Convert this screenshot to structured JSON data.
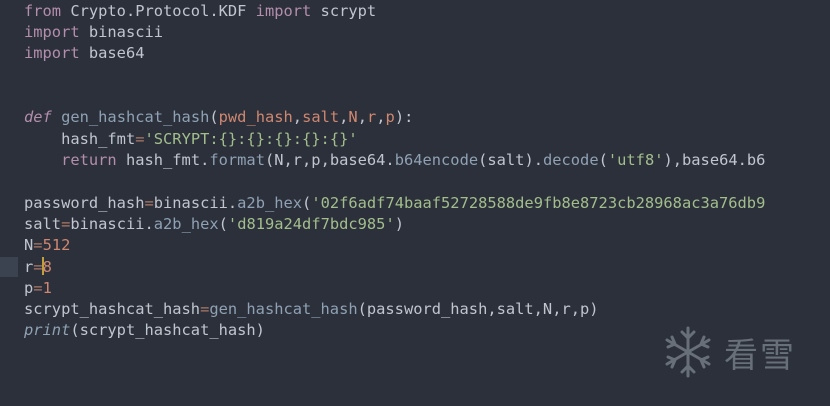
{
  "editor": {
    "lines": [
      {
        "t1": "from",
        "t2": " Crypto.Protocol.KDF ",
        "t3": "import",
        "t4": " scrypt"
      },
      {
        "t1": "import",
        "t2": " binascii"
      },
      {
        "t1": "import",
        "t2": " base64"
      },
      {},
      {},
      {
        "kw": "def",
        "name": "gen_hashcat_hash",
        "open": "(",
        "args": [
          "pwd_hash",
          "salt",
          "N",
          "r",
          "p"
        ],
        "close": "):"
      },
      {
        "var": "hash_fmt",
        "eq": "=",
        "str": "'SCRYPT:{}:{}:{}:{}:{}'"
      },
      {
        "ret": "return",
        "a": " hash_fmt.",
        "fmt": "format",
        "b": "(N,r,p,base64.",
        "enc": "b64encode",
        "c": "(salt).",
        "dec": "decode",
        "d": "(",
        "s": "'utf8'",
        "e": "),base64.b6"
      },
      {},
      {
        "var": "password_hash",
        "eq": "=",
        "mod": "binascii.",
        "fn": "a2b_hex",
        "open": "(",
        "str": "'02f6adf74baaf52728588de9fb8e8723cb28968ac3a76db9"
      },
      {
        "var": "salt",
        "eq": "=",
        "mod": "binascii.",
        "fn": "a2b_hex",
        "open": "(",
        "str": "'d819a24df7bdc985'",
        "close": ")"
      },
      {
        "var": "N",
        "eq": "=",
        "num": "512"
      },
      {
        "var": "r",
        "eq": "=",
        "num": "8"
      },
      {
        "var": "p",
        "eq": "=",
        "num": "1"
      },
      {
        "var": "scrypt_hashcat_hash",
        "eq": "=",
        "fn": "gen_hashcat_hash",
        "args": "(password_hash,salt,N,r,p)"
      },
      {
        "fn": "print",
        "args": "(scrypt_hashcat_hash)"
      }
    ]
  },
  "watermark": {
    "text": "看雪",
    "icon": "snowflake-icon"
  },
  "colors": {
    "background": "#2b303b",
    "keyword": "#b48ead",
    "function": "#8fa1b3",
    "string": "#a3be8c",
    "number": "#d08770",
    "operator": "#ab7967",
    "text": "#c0c5ce"
  }
}
